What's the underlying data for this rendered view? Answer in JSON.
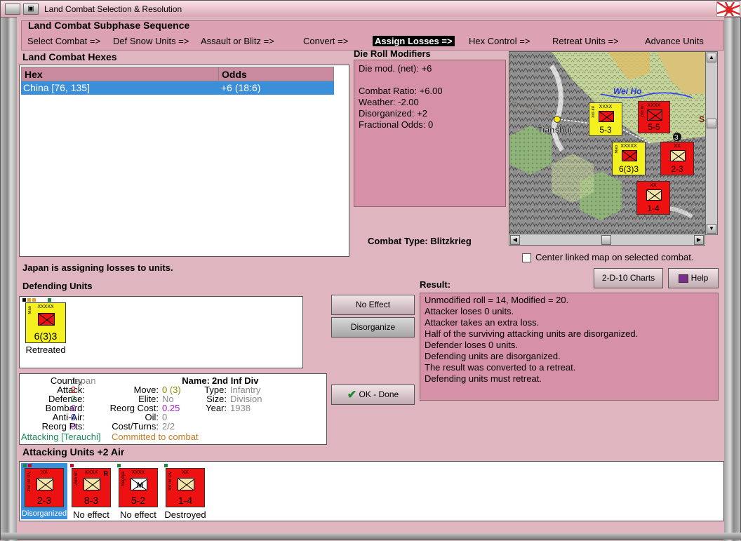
{
  "window": {
    "title": "Land Combat Selection & Resolution"
  },
  "sequence": {
    "title": "Land Combat Subphase Sequence",
    "steps": [
      "Select Combat =>",
      "Def Snow Units =>",
      "Assault or Blitz =>",
      "Convert =>",
      "Assign Losses =>",
      "Hex Control =>",
      "Retreat Units =>",
      "Advance Units"
    ],
    "active_index": 4
  },
  "hexes": {
    "title": "Land Combat Hexes",
    "col_hex": "Hex",
    "col_odds": "Odds",
    "rows": [
      {
        "hex": "China [76, 135]",
        "odds": "+6 (18:6)"
      }
    ]
  },
  "die_mods": {
    "title": "Die Roll Modifiers",
    "lines": [
      "Die mod. (net): +6",
      "",
      "Combat Ratio: +6.00",
      "Weather: -2.00",
      "Disorganized: +2",
      "Fractional Odds: 0"
    ]
  },
  "combat_type": {
    "label": "Combat Type:",
    "value": "Blitzkrieg"
  },
  "map": {
    "labels": {
      "river": "Wei Ho",
      "city": "Tianshui",
      "hex_num": "3",
      "edge": "S"
    },
    "units": [
      {
        "side": "3rd Inf",
        "size": "XXXX",
        "str": "5-3",
        "color": "#f5f020"
      },
      {
        "side": "2nd Inf",
        "size": "XXXX",
        "str": "5-5",
        "color": "#ee1111"
      },
      {
        "side": "Mao",
        "size": "XXXXX",
        "str": "6(3)3",
        "color": "#f5f020"
      },
      {
        "side": "",
        "size": "XX",
        "str": "2-3",
        "color": "#ee1111"
      },
      {
        "side": "",
        "size": "XX",
        "str": "1-4",
        "color": "#ee1111"
      }
    ]
  },
  "center_map": {
    "label": "Center linked map on selected combat.",
    "checked": false
  },
  "status": "Japan is assigning losses to units.",
  "defending": {
    "title": "Defending Units",
    "units": [
      {
        "side": "Mao",
        "size": "XXXXX",
        "str": "6(3)3",
        "label": "Retreated",
        "color": "#f5f020"
      }
    ]
  },
  "buttons": {
    "no_effect": "No Effect",
    "disorganize": "Disorganize",
    "ok_done": "OK - Done",
    "charts": "2-D-10 Charts",
    "help": "Help"
  },
  "result": {
    "title": "Result:",
    "lines": [
      "Unmodified roll = 14, Modified = 20.",
      "Attacker loses 0 units.",
      "Attacker takes an extra loss.",
      "Half of the surviving attacking units are disorganized.",
      "Defender loses 0 units.",
      "Defending units are disorganized.",
      "The result was converted to a retreat.",
      "Defending units must retreat."
    ]
  },
  "unit_info": {
    "country_l": "Country:",
    "country": "Japan",
    "attack_l": "Attack:",
    "attack": "2",
    "defense_l": "Defense:",
    "defense": "2",
    "bombard_l": "Bombard:",
    "bombard": "0",
    "antiair_l": "Anti-Air:",
    "antiair": "0",
    "reorgpts_l": "Reorg Pts:",
    "reorgpts": "0",
    "name_l": "Name:",
    "name": "2nd Inf Div",
    "move_l": "Move:",
    "move": "0 (3)",
    "type_l": "Type:",
    "type": "Infantry",
    "elite_l": "Elite:",
    "elite": "No",
    "size_l": "Size:",
    "size": "Division",
    "reorgcost_l": "Reorg Cost:",
    "reorgcost": "0.25",
    "year_l": "Year:",
    "year": "1938",
    "oil_l": "Oil:",
    "oil": "0",
    "costturns_l": "Cost/Turns:",
    "costturns": "2/2",
    "attacking": "Attacking [Terauchi]",
    "committed": "Committed to combat"
  },
  "attacking": {
    "title": "Attacking Units +2 Air",
    "units": [
      {
        "side": "2nd Inf Div",
        "size": "XX",
        "str": "2-3",
        "label": "Disorganized",
        "color": "#ee1111"
      },
      {
        "side": "25th Inf",
        "size": "XXXX",
        "str": "8-3",
        "label": "No effect",
        "color": "#ee1111",
        "badge": "R"
      },
      {
        "side": "Nagoya",
        "size": "XXXX",
        "str": "5-2",
        "label": "No effect",
        "color": "#ee1111"
      },
      {
        "side": "3rd Inf Div",
        "size": "XX",
        "str": "1-4",
        "label": "Destroyed",
        "color": "#ee1111"
      }
    ]
  },
  "colors": {
    "accent": "#3b8fd9",
    "panel": "#d691a8",
    "japan": "#ee1111",
    "china": "#f5f020"
  }
}
